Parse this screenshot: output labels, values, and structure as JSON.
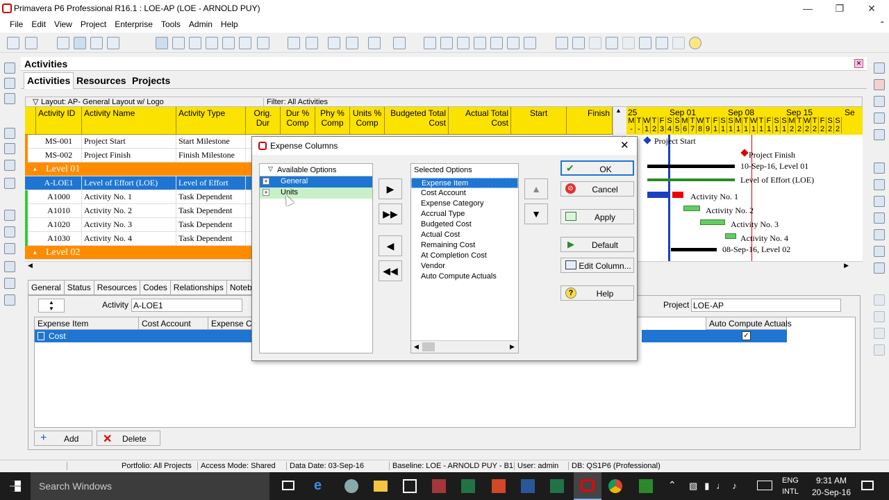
{
  "window": {
    "title": "Primavera P6 Professional R16.1 : LOE-AP (LOE - ARNOLD PUY)"
  },
  "menu": [
    "File",
    "Edit",
    "View",
    "Project",
    "Enterprise",
    "Tools",
    "Admin",
    "Help"
  ],
  "activities": {
    "title": "Activities",
    "tabs": [
      "Activities",
      "Resources",
      "Projects"
    ],
    "layout": "Layout: AP- General Layout w/ Logo",
    "filter": "Filter: All Activities",
    "columns": {
      "id": "Activity ID",
      "name": "Activity Name",
      "type": "Activity Type",
      "orig1": "Orig.",
      "orig2": "Dur",
      "dur1": "Dur %",
      "dur2": "Comp",
      "phy1": "Phy %",
      "phy2": "Comp",
      "units1": "Units %",
      "units2": "Comp",
      "btc1": "Budgeted Total",
      "btc2": "Cost",
      "atc1": "Actual Total",
      "atc2": "Cost",
      "start": "Start",
      "finish": "Finish"
    },
    "rows": [
      {
        "id": "MS-001",
        "name": "Project Start",
        "type": "Start Milestone"
      },
      {
        "id": "MS-002",
        "name": "Project Finish",
        "type": "Finish Milestone"
      },
      {
        "group": "Level 01"
      },
      {
        "id": "A-LOE1",
        "name": "Level of Effort (LOE)",
        "type": "Level of Effort",
        "selected": true
      },
      {
        "id": "A1000",
        "name": "Activity No. 1",
        "type": "Task Dependent"
      },
      {
        "id": "A1010",
        "name": "Activity No. 2",
        "type": "Task Dependent"
      },
      {
        "id": "A1020",
        "name": "Activity No. 3",
        "type": "Task Dependent"
      },
      {
        "id": "A1030",
        "name": "Activity No. 4",
        "type": "Task Dependent"
      },
      {
        "group": "Level 02"
      }
    ]
  },
  "gantt": {
    "months": [
      "25",
      "Sep 01",
      "Sep 08",
      "Sep 15",
      "Se"
    ],
    "days": [
      "M",
      "T",
      "W",
      "T",
      "F",
      "S",
      "S",
      "M",
      "T",
      "W",
      "T",
      "F",
      "S",
      "S",
      "M",
      "T",
      "W",
      "T",
      "F",
      "S",
      "S",
      "M",
      "T",
      "W",
      "T",
      "F",
      "S",
      "S"
    ],
    "nums": [
      "-",
      "-",
      "1",
      "2",
      "3",
      "4",
      "5",
      "6",
      "7",
      "8",
      "9",
      "1",
      "1",
      "1",
      "1",
      "1",
      "1",
      "1",
      "1",
      "1",
      "1",
      "2",
      "2",
      "2",
      "2",
      "2",
      "2",
      "2"
    ],
    "labels": {
      "start": "Project Start",
      "finish": "Project Finish",
      "l1": "10-Sep-16, Level 01",
      "loe": "Level of Effort (LOE)",
      "a1": "Activity No. 1",
      "a2": "Activity No. 2",
      "a3": "Activity No. 3",
      "a4": "Activity No. 4",
      "l2": "08-Sep-16, Level 02"
    }
  },
  "details": {
    "tabs": [
      "General",
      "Status",
      "Resources",
      "Codes",
      "Relationships",
      "Notebook"
    ],
    "activity_label": "Activity",
    "activity_value": "A-LOE1",
    "project_label": "Project",
    "project_value": "LOE-AP",
    "cols": {
      "item": "Expense Item",
      "account": "Cost Account",
      "cat": "Expense Cat",
      "auto": "Auto Compute Actuals"
    },
    "row": {
      "item": "Cost"
    },
    "add": "Add",
    "delete": "Delete"
  },
  "dialog": {
    "title": "Expense Columns",
    "available_header": "Available Options",
    "available": [
      "General",
      "Units"
    ],
    "selected_header": "Selected Options",
    "selected": [
      "Expense Item",
      "Cost Account",
      "Expense Category",
      "Accrual Type",
      "Budgeted Cost",
      "Actual Cost",
      "Remaining Cost",
      "At Completion Cost",
      "Vendor",
      "Auto Compute Actuals"
    ],
    "buttons": {
      "ok": "OK",
      "cancel": "Cancel",
      "apply": "Apply",
      "default": "Default",
      "edit": "Edit Column...",
      "help": "Help"
    }
  },
  "status": {
    "portfolio": "Portfolio: All Projects",
    "access": "Access Mode: Shared",
    "data_date": "Data Date: 03-Sep-16",
    "baseline": "Baseline: LOE - ARNOLD PUY - B1",
    "user": "User: admin",
    "db": "DB: QS1P6 (Professional)"
  },
  "taskbar": {
    "search": "Search Windows",
    "time": "9:31 AM",
    "date": "20-Sep-16",
    "lang1": "ENG",
    "lang2": "INTL"
  }
}
